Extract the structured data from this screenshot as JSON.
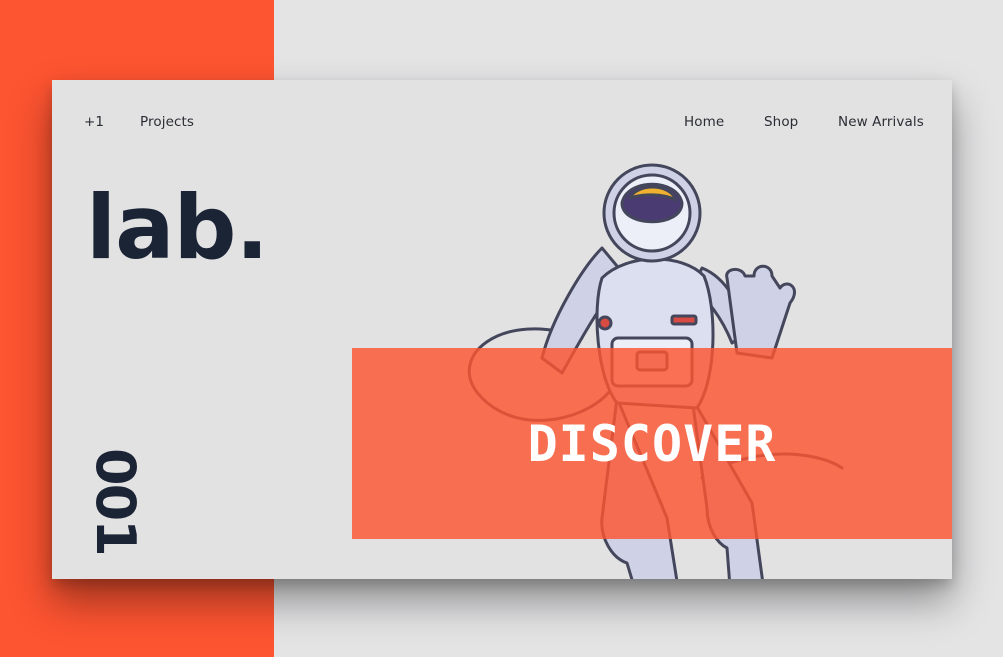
{
  "colors": {
    "accent": "#fd5431",
    "background": "#e4e4e5",
    "card": "#e2e2e3",
    "text_dark": "#1b2435"
  },
  "nav": {
    "left_items": [
      "+1",
      "Projects"
    ],
    "right_items": [
      "Home",
      "Shop",
      "New Arrivals"
    ]
  },
  "brand": {
    "logo": "lab."
  },
  "counter": "001",
  "hero": {
    "illustration": "astronaut-illustration",
    "cta_label": "DISCOVER"
  }
}
